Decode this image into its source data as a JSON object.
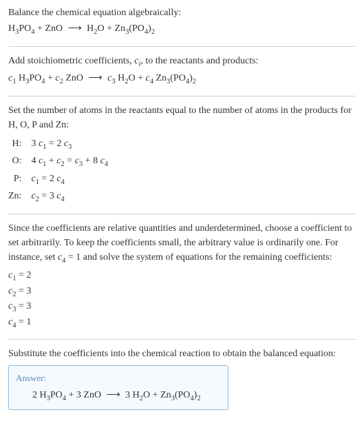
{
  "s1": {
    "p1": "Balance the chemical equation algebraically:"
  },
  "s2": {
    "p1": "Add stoichiometric coefficients, cᵢ, to the reactants and products:"
  },
  "s3": {
    "p1": "Set the number of atoms in the reactants equal to the number of atoms in the products for H, O, P and Zn:",
    "rows": [
      {
        "label": "H:",
        "val": "3 c₁ = 2 c₃"
      },
      {
        "label": "O:",
        "val": "4 c₁ + c₂ = c₃ + 8 c₄"
      },
      {
        "label": "P:",
        "val": "c₁ = 2 c₄"
      },
      {
        "label": "Zn:",
        "val": "c₂ = 3 c₄"
      }
    ]
  },
  "s4": {
    "p1": "Since the coefficients are relative quantities and underdetermined, choose a coefficient to set arbitrarily. To keep the coefficients small, the arbitrary value is ordinarily one. For instance, set c₄ = 1 and solve the system of equations for the remaining coefficients:",
    "coefs": [
      "c₁ = 2",
      "c₂ = 3",
      "c₃ = 3",
      "c₄ = 1"
    ]
  },
  "s5": {
    "p1": "Substitute the coefficients into the chemical reaction to obtain the balanced equation:",
    "answer_label": "Answer:"
  },
  "chart_data": {
    "type": "table",
    "title": "Balancing H3PO4 + ZnO → H2O + Zn3(PO4)2",
    "unbalanced_equation": "H3PO4 + ZnO → H2O + Zn3(PO4)2",
    "generic_equation": "c1 H3PO4 + c2 ZnO → c3 H2O + c4 Zn3(PO4)2",
    "atom_balance_equations": {
      "H": "3 c1 = 2 c3",
      "O": "4 c1 + c2 = c3 + 8 c4",
      "P": "c1 = 2 c4",
      "Zn": "c2 = 3 c4"
    },
    "arbitrary_set": {
      "c4": 1
    },
    "solution": {
      "c1": 2,
      "c2": 3,
      "c3": 3,
      "c4": 1
    },
    "balanced_equation": "2 H3PO4 + 3 ZnO → 3 H2O + Zn3(PO4)2"
  }
}
